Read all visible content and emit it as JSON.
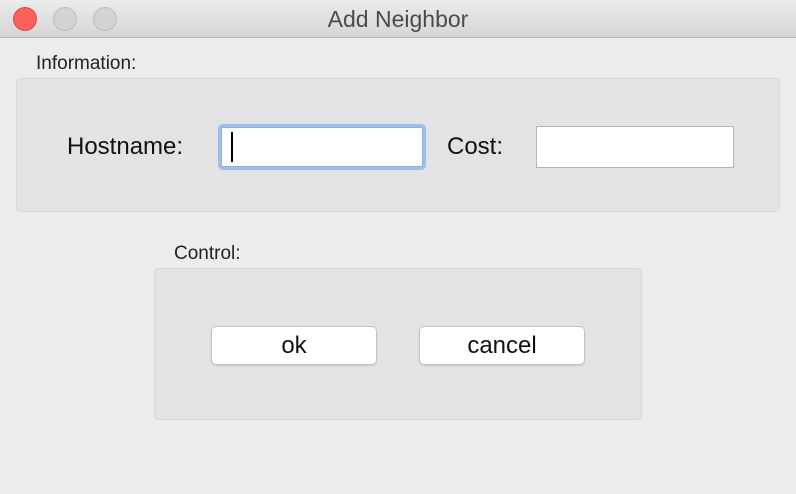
{
  "window": {
    "title": "Add Neighbor",
    "colors": {
      "close": "#fc605b",
      "inactive": "#d3d3d3",
      "focus_ring": "#9cbfeb"
    }
  },
  "information": {
    "label": "Information:",
    "hostname_label": "Hostname:",
    "hostname_value": "",
    "cost_label": "Cost:",
    "cost_value": ""
  },
  "control": {
    "label": "Control:",
    "ok_label": "ok",
    "cancel_label": "cancel"
  }
}
